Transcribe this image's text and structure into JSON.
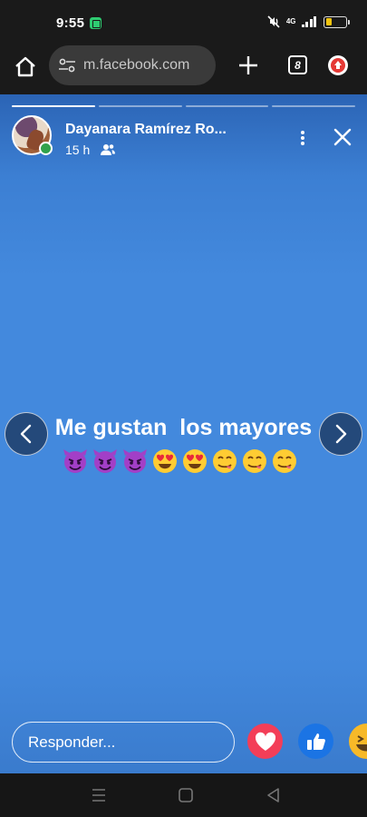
{
  "status_bar": {
    "time": "9:55",
    "network_label": "4G",
    "battery_level": 0.25,
    "icons": [
      "app-notification-icon",
      "mute-icon",
      "signal-icon",
      "battery-icon"
    ]
  },
  "browser": {
    "url": "m.facebook.com",
    "tab_count": "8",
    "icons": [
      "home-icon",
      "site-settings-icon",
      "plus-icon",
      "tab-switcher-icon",
      "update-icon"
    ]
  },
  "story": {
    "progress_segments": 4,
    "active_segment": 1,
    "poster_name": "Dayanara Ramírez Ro...",
    "time": "15 h",
    "audience_icon": "friends-icon",
    "text_line": "Me gustan  los mayores",
    "emojis": [
      "smiling-imp",
      "smiling-imp",
      "smiling-imp",
      "heart-eyes",
      "heart-eyes",
      "yum",
      "yum",
      "yum"
    ],
    "background_color": "#4389dd"
  },
  "reply": {
    "placeholder": "Responder...",
    "reactions": [
      "love",
      "like",
      "haha"
    ]
  },
  "system_nav": {
    "icons": [
      "recents-icon",
      "home-icon",
      "back-icon"
    ]
  }
}
